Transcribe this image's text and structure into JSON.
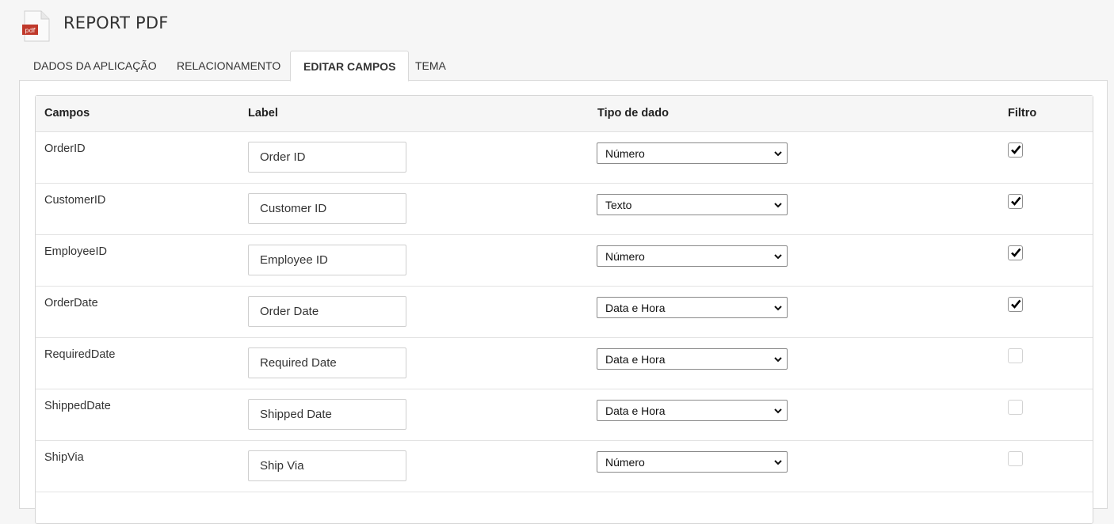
{
  "app": {
    "title": "REPORT PDF",
    "icon_text": "pdf"
  },
  "tabs": [
    {
      "label": "DADOS DA APLICAÇÃO",
      "active": false
    },
    {
      "label": "RELACIONAMENTO",
      "active": false
    },
    {
      "label": "EDITAR CAMPOS",
      "active": true
    },
    {
      "label": "TEMA",
      "active": false
    }
  ],
  "table": {
    "headers": {
      "fields": "Campos",
      "label": "Label",
      "type": "Tipo de dado",
      "filter": "Filtro"
    },
    "rows": [
      {
        "field": "OrderID",
        "label": "Order ID",
        "type": "Número",
        "filter": true
      },
      {
        "field": "CustomerID",
        "label": "Customer ID",
        "type": "Texto",
        "filter": true
      },
      {
        "field": "EmployeeID",
        "label": "Employee ID",
        "type": "Número",
        "filter": true
      },
      {
        "field": "OrderDate",
        "label": "Order Date",
        "type": "Data e Hora",
        "filter": true
      },
      {
        "field": "RequiredDate",
        "label": "Required Date",
        "type": "Data e Hora",
        "filter": false
      },
      {
        "field": "ShippedDate",
        "label": "Shipped Date",
        "type": "Data e Hora",
        "filter": false
      },
      {
        "field": "ShipVia",
        "label": "Ship Via",
        "type": "Número",
        "filter": false
      }
    ]
  },
  "colors": {
    "icon_red": "#c0392b",
    "check": "#000000"
  }
}
